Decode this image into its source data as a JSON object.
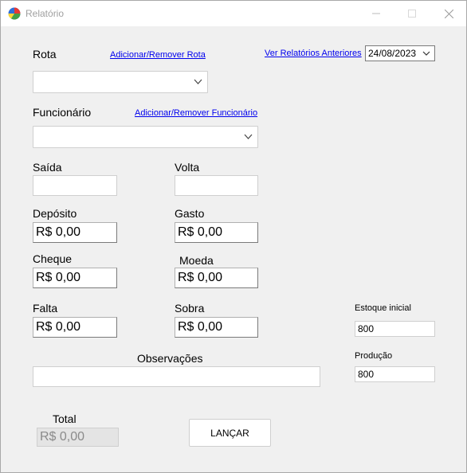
{
  "window": {
    "title": "Relatório",
    "icon": "pie-chart-app-icon"
  },
  "form": {
    "rota_label": "Rota",
    "rota_link": "Adicionar/Remover Rota",
    "ver_relatorios_link": "Ver Relatórios Anteriores",
    "date_value": "24/08/2023",
    "funcionario_label": "Funcionário",
    "funcionario_link": "Adicionar/Remover Funcionário",
    "saida_label": "Saída",
    "volta_label": "Volta",
    "deposito_label": "Depósito",
    "deposito_value": "R$ 0,00",
    "gasto_label": "Gasto",
    "gasto_value": "R$ 0,00",
    "cheque_label": "Cheque",
    "cheque_value": "R$ 0,00",
    "moeda_label": "Moeda",
    "moeda_value": "R$ 0,00",
    "falta_label": "Falta",
    "falta_value": "R$ 0,00",
    "sobra_label": "Sobra",
    "sobra_value": "R$ 0,00",
    "estoque_label": "Estoque inicial",
    "estoque_value": "800",
    "producao_label": "Produção",
    "producao_value": "800",
    "observacoes_label": "Observações",
    "total_label": "Total",
    "total_value": "R$ 0,00",
    "lancar_button": "LANÇAR"
  }
}
